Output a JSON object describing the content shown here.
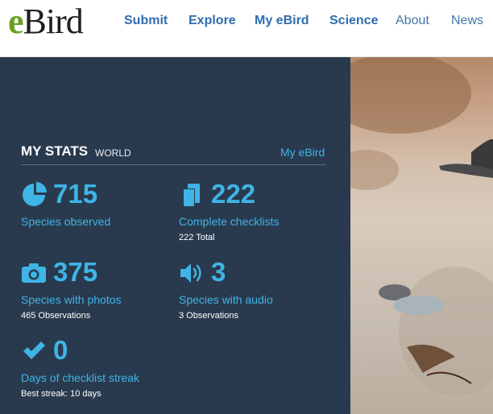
{
  "header": {
    "logo_e": "e",
    "logo_bird": "Bird",
    "nav": [
      {
        "label": "Submit"
      },
      {
        "label": "Explore"
      },
      {
        "label": "My eBird"
      },
      {
        "label": "Science"
      },
      {
        "label": "About"
      },
      {
        "label": "News"
      }
    ]
  },
  "stats": {
    "title": "MY STATS",
    "scope": "WORLD",
    "link": "My eBird",
    "items": [
      {
        "icon": "species-icon",
        "value": "715",
        "label": "Species observed",
        "detail": ""
      },
      {
        "icon": "checklists-icon",
        "value": "222",
        "label": "Complete checklists",
        "detail": "222 Total"
      },
      {
        "icon": "camera-icon",
        "value": "375",
        "label": "Species with photos",
        "detail": "465 Observations"
      },
      {
        "icon": "audio-icon",
        "value": "3",
        "label": "Species with audio",
        "detail": "3 Observations"
      },
      {
        "icon": "checkmark-icon",
        "value": "0",
        "label": "Days of checklist streak",
        "detail": "Best streak: 10 days"
      }
    ]
  },
  "colors": {
    "panel_bg": "#293a4e",
    "accent": "#3fb4e6",
    "nav_link": "#2f6db0",
    "logo_green": "#6aa121"
  }
}
